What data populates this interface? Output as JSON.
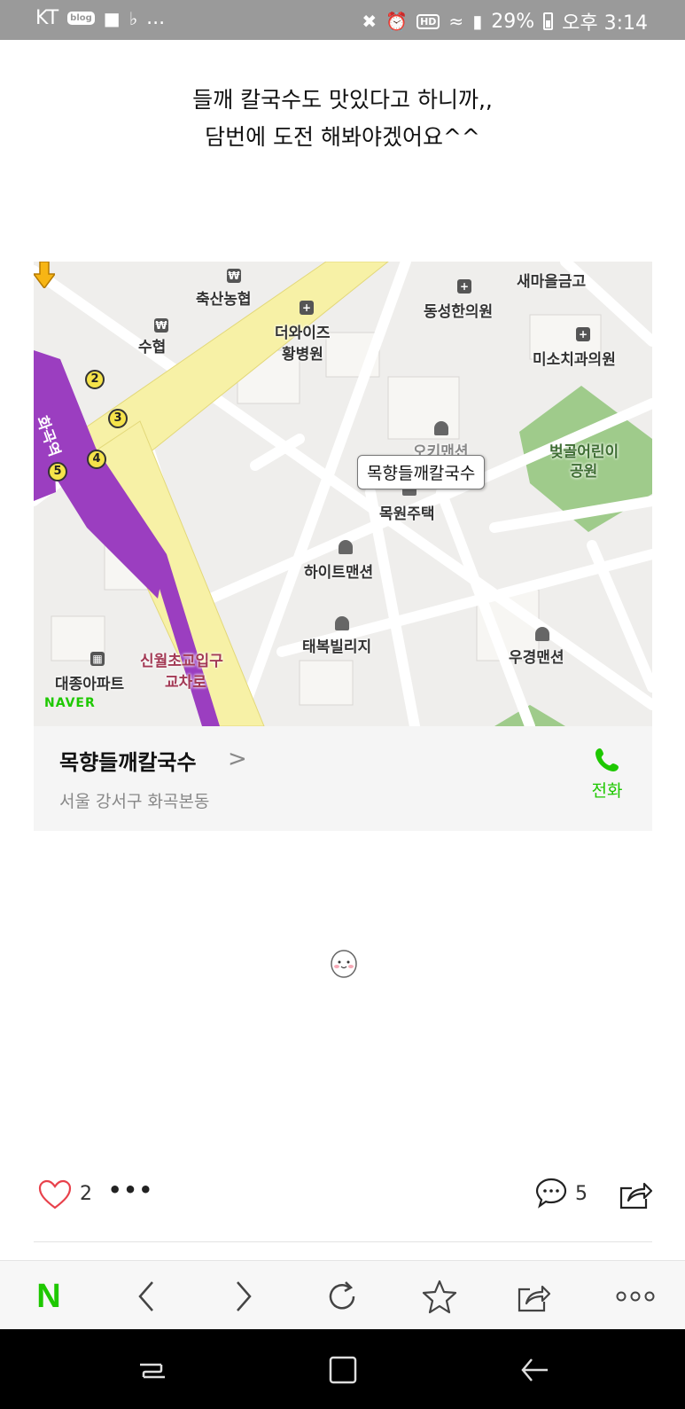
{
  "status_bar": {
    "carrier": "KT",
    "blog_badge": "blog",
    "battery": "29%",
    "time": "오후 3:14",
    "more": "..."
  },
  "post": {
    "line1": "들깨 칼국수도 맛있다고 하니까,,",
    "line2": "담번에 도전 해봐야겠어요^^"
  },
  "map": {
    "labels": {
      "saemaeul": "새마을금고",
      "chuksan": "축산농협",
      "donghyup": "수협",
      "dongseong": "동성한의원",
      "thewise1": "더와이즈",
      "thewise2": "황병원",
      "miso": "미소치과의원",
      "beotgol1": "벚골어린이",
      "beotgol2": "공원",
      "okgi": "오키맨션",
      "mokwon": "목원주택",
      "height": "하이트맨션",
      "taebok": "태복빌리지",
      "ugyeong": "우경맨션",
      "daejong": "대종아파트",
      "sinwol1": "신월초교입구",
      "sinwol2": "교차로",
      "station": "화곡역",
      "logo": "NAVER"
    },
    "exits": [
      "2",
      "3",
      "4",
      "5"
    ],
    "callout": "목향들깨칼국수"
  },
  "place": {
    "name": "목향들깨칼국수",
    "chevron": ">",
    "address": "서울 강서구 화곡본동",
    "call_label": "전화"
  },
  "actions": {
    "like_count": "2",
    "more": "•••",
    "comment_count": "5"
  },
  "toolbar": {
    "naver": "N"
  },
  "colors": {
    "naver_green": "#1ec800",
    "status_bar": "#9a9a9a",
    "like_red": "#e8414b",
    "subway_purple": "#9b3ec0",
    "road_yellow": "#f7f1a6",
    "park_green": "#9fcb8b"
  }
}
